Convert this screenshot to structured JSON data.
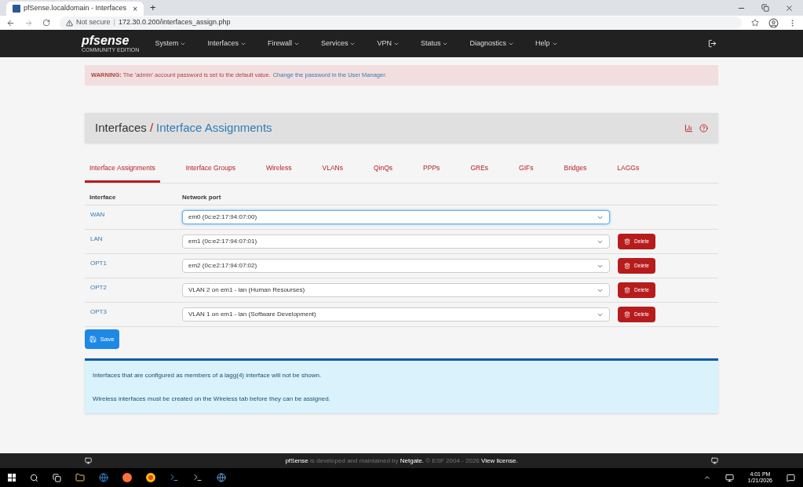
{
  "browser": {
    "tab_title": "pfSense.localdomain - Interfaces",
    "tab_close": "×",
    "new_tab": "+",
    "not_secure": "Not secure",
    "separator": "|",
    "url": "172.30.0.200/interfaces_assign.php"
  },
  "brand": {
    "logo": "pfsense",
    "edition": "COMMUNITY EDITION"
  },
  "nav": [
    {
      "label": "System"
    },
    {
      "label": "Interfaces"
    },
    {
      "label": "Firewall"
    },
    {
      "label": "Services"
    },
    {
      "label": "VPN"
    },
    {
      "label": "Status"
    },
    {
      "label": "Diagnostics"
    },
    {
      "label": "Help"
    }
  ],
  "warning": {
    "text": "**WARNING:** The 'admin' account password is set to the default value.",
    "link": "Change the password in the User Manager."
  },
  "breadcrumb": {
    "parent": "Interfaces",
    "separator": "/",
    "current": "Interface Assignments"
  },
  "tabs": [
    {
      "label": "Interface Assignments",
      "selected": true
    },
    {
      "label": "Interface Groups",
      "selected": false
    },
    {
      "label": "Wireless",
      "selected": false
    },
    {
      "label": "VLANs",
      "selected": false
    },
    {
      "label": "QinQs",
      "selected": false
    },
    {
      "label": "PPPs",
      "selected": false
    },
    {
      "label": "GREs",
      "selected": false
    },
    {
      "label": "GIFs",
      "selected": false
    },
    {
      "label": "Bridges",
      "selected": false
    },
    {
      "label": "LAGGs",
      "selected": false
    }
  ],
  "table": {
    "columns": [
      "Interface",
      "Network port"
    ],
    "rows": [
      {
        "interface": "WAN",
        "port": "em0 (0c:e2:17:94:07:00)",
        "focused": true
      },
      {
        "interface": "LAN",
        "port": "em1 (0c:e2:17:94:07:01)",
        "focused": false,
        "delete_label": "Delete"
      },
      {
        "interface": "OPT1",
        "port": "em2 (0c:e2:17:94:07:02)",
        "focused": false,
        "delete_label": "Delete"
      },
      {
        "interface": "OPT2",
        "port": "VLAN 2 on em1 - lan (Human Resourses)",
        "focused": false,
        "delete_label": "Delete"
      },
      {
        "interface": "OPT3",
        "port": "VLAN 1 on em1 - lan (Software Development)",
        "focused": false,
        "delete_label": "Delete"
      }
    ]
  },
  "save_label": "Save",
  "info": [
    "Interfaces that are configured as members of a lagg(4) interface will not be shown.",
    "Wireless interfaces must be created on the Wireless tab before they can be assigned."
  ],
  "footer": {
    "brand": "pfSense",
    "middle": " is developed and maintained by ",
    "company": "Netgate.",
    "copyright": " © ESF 2004 - 2026 ",
    "license": "View license."
  },
  "taskbar": {
    "time": "4:01 PM",
    "date": "1/21/2026"
  }
}
